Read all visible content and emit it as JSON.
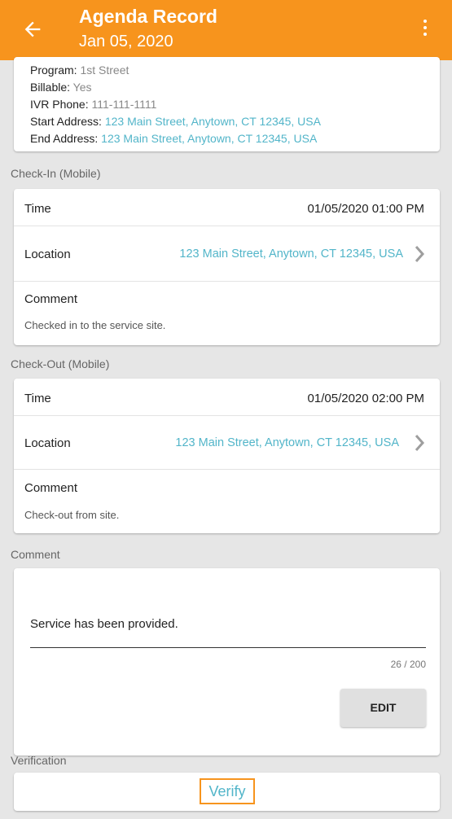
{
  "header": {
    "title": "Agenda Record",
    "subtitle": "Jan 05, 2020",
    "back_icon": "arrow-left-icon",
    "menu_icon": "more-vert-icon",
    "accent_color": "#f7941d"
  },
  "details": {
    "program_label": "Program:",
    "program_value": "1st Street",
    "billable_label": "Billable:",
    "billable_value": "Yes",
    "ivr_label": "IVR Phone:",
    "ivr_value": "111-111-1111",
    "start_label": "Start Address:",
    "start_value": "123 Main Street, Anytown, CT 12345, USA",
    "end_label": "End Address:",
    "end_value": "123 Main Street, Anytown, CT 12345, USA"
  },
  "checkin": {
    "section_title": "Check-In (Mobile)",
    "time_label": "Time",
    "time_value": "01/05/2020  01:00 PM",
    "location_label": "Location",
    "location_value": "123 Main Street, Anytown, CT 12345, USA",
    "comment_label": "Comment",
    "comment_value": "Checked in to the service site."
  },
  "checkout": {
    "section_title": "Check-Out (Mobile)",
    "time_label": "Time",
    "time_value": "01/05/2020  02:00 PM",
    "location_label": "Location",
    "location_value": "123 Main Street, Anytown, CT 12345, USA",
    "comment_label": "Comment",
    "comment_value": "Check-out from site."
  },
  "comment": {
    "section_title": "Comment",
    "text": "Service has been provided.",
    "counter": "26 / 200",
    "edit_label": "EDIT"
  },
  "verification": {
    "section_title": "Verification",
    "verify_label": "Verify",
    "link_color": "#52b5c9"
  }
}
